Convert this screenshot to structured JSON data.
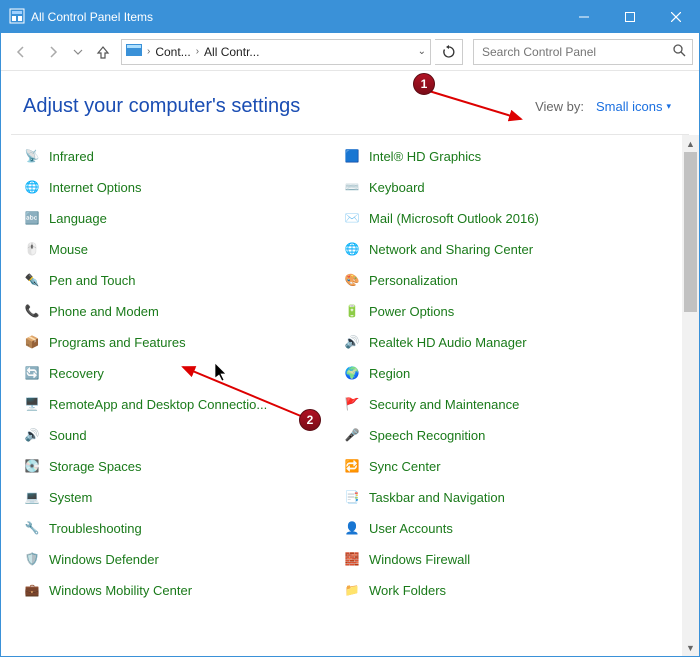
{
  "window": {
    "title": "All Control Panel Items"
  },
  "breadcrumb": {
    "seg1": "Cont...",
    "seg2": "All Contr..."
  },
  "search": {
    "placeholder": "Search Control Panel"
  },
  "heading": "Adjust your computer's settings",
  "viewby": {
    "label": "View by:",
    "value": "Small icons"
  },
  "left_items": [
    {
      "label": "Infrared",
      "icon": "📡",
      "name": "infrared"
    },
    {
      "label": "Internet Options",
      "icon": "🌐",
      "name": "internet-options"
    },
    {
      "label": "Language",
      "icon": "🔤",
      "name": "language"
    },
    {
      "label": "Mouse",
      "icon": "🖱️",
      "name": "mouse"
    },
    {
      "label": "Pen and Touch",
      "icon": "✒️",
      "name": "pen-and-touch"
    },
    {
      "label": "Phone and Modem",
      "icon": "📞",
      "name": "phone-and-modem"
    },
    {
      "label": "Programs and Features",
      "icon": "📦",
      "name": "programs-and-features"
    },
    {
      "label": "Recovery",
      "icon": "🔄",
      "name": "recovery"
    },
    {
      "label": "RemoteApp and Desktop Connectio...",
      "icon": "🖥️",
      "name": "remoteapp"
    },
    {
      "label": "Sound",
      "icon": "🔊",
      "name": "sound"
    },
    {
      "label": "Storage Spaces",
      "icon": "💽",
      "name": "storage-spaces"
    },
    {
      "label": "System",
      "icon": "💻",
      "name": "system"
    },
    {
      "label": "Troubleshooting",
      "icon": "🔧",
      "name": "troubleshooting"
    },
    {
      "label": "Windows Defender",
      "icon": "🛡️",
      "name": "windows-defender"
    },
    {
      "label": "Windows Mobility Center",
      "icon": "💼",
      "name": "windows-mobility"
    }
  ],
  "right_items": [
    {
      "label": "Intel® HD Graphics",
      "icon": "🟦",
      "name": "intel-hd-graphics"
    },
    {
      "label": "Keyboard",
      "icon": "⌨️",
      "name": "keyboard"
    },
    {
      "label": "Mail (Microsoft Outlook 2016)",
      "icon": "✉️",
      "name": "mail"
    },
    {
      "label": "Network and Sharing Center",
      "icon": "🌐",
      "name": "network-sharing"
    },
    {
      "label": "Personalization",
      "icon": "🎨",
      "name": "personalization"
    },
    {
      "label": "Power Options",
      "icon": "🔋",
      "name": "power-options"
    },
    {
      "label": "Realtek HD Audio Manager",
      "icon": "🔊",
      "name": "realtek-audio"
    },
    {
      "label": "Region",
      "icon": "🌍",
      "name": "region"
    },
    {
      "label": "Security and Maintenance",
      "icon": "🚩",
      "name": "security-maintenance"
    },
    {
      "label": "Speech Recognition",
      "icon": "🎤",
      "name": "speech-recognition"
    },
    {
      "label": "Sync Center",
      "icon": "🔁",
      "name": "sync-center"
    },
    {
      "label": "Taskbar and Navigation",
      "icon": "📑",
      "name": "taskbar-nav"
    },
    {
      "label": "User Accounts",
      "icon": "👤",
      "name": "user-accounts"
    },
    {
      "label": "Windows Firewall",
      "icon": "🧱",
      "name": "windows-firewall"
    },
    {
      "label": "Work Folders",
      "icon": "📁",
      "name": "work-folders"
    }
  ],
  "annotations": {
    "badge1": "1",
    "badge2": "2"
  }
}
